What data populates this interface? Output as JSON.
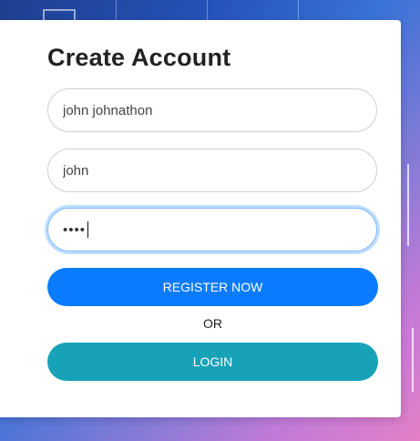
{
  "form": {
    "title": "Create Account",
    "full_name_value": "john johnathon",
    "username_value": "john",
    "password_masked": "••••",
    "register_label": "REGISTER NOW",
    "or_label": "OR",
    "login_label": "LOGIN"
  },
  "colors": {
    "register_button": "#0a7bff",
    "login_button": "#17a2b8",
    "focus_ring": "#80b8ff"
  }
}
